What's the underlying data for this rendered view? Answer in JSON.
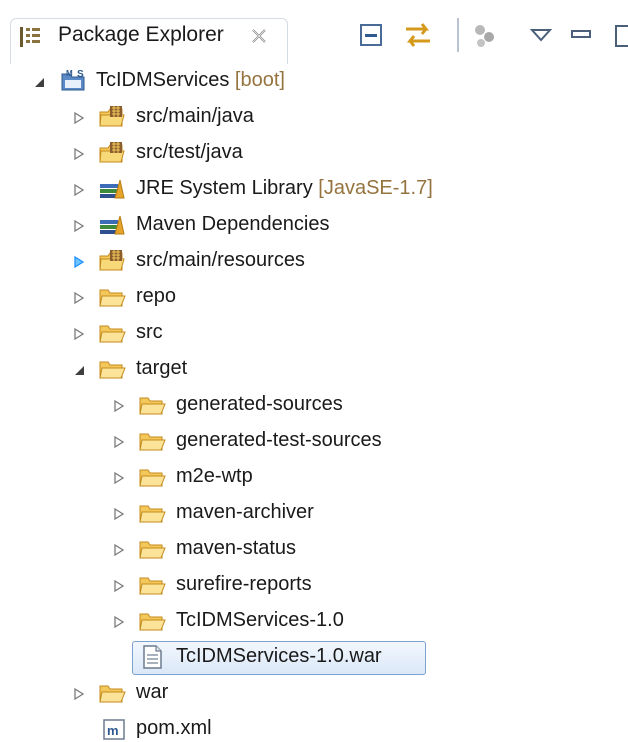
{
  "view": {
    "title": "Package Explorer",
    "close_icon": "close-icon",
    "toolbar": [
      "collapse-all-icon",
      "link-with-editor-icon",
      "filters-icon",
      "view-menu-icon",
      "minimize-icon",
      "maximize-icon"
    ]
  },
  "tree": {
    "project": {
      "name": "TcIDMServices",
      "decoration": " [boot]",
      "icon": "maven-project-icon",
      "expanded": true
    },
    "children": [
      {
        "label": "src/main/java",
        "icon": "source-folder-icon",
        "expanded": false
      },
      {
        "label": "src/test/java",
        "icon": "source-folder-icon",
        "expanded": false
      },
      {
        "label": "JRE System Library",
        "decoration": " [JavaSE-1.7]",
        "icon": "library-icon",
        "expanded": false
      },
      {
        "label": "Maven Dependencies",
        "icon": "library-icon",
        "expanded": false
      },
      {
        "label": "src/main/resources",
        "icon": "source-folder-icon",
        "expanded": false,
        "twisty_highlight": true
      },
      {
        "label": "repo",
        "icon": "folder-icon",
        "expanded": false
      },
      {
        "label": "src",
        "icon": "folder-icon",
        "expanded": false
      },
      {
        "label": "target",
        "icon": "folder-icon",
        "expanded": true,
        "children": [
          {
            "label": "generated-sources",
            "icon": "folder-icon"
          },
          {
            "label": "generated-test-sources",
            "icon": "folder-icon"
          },
          {
            "label": "m2e-wtp",
            "icon": "folder-icon"
          },
          {
            "label": "maven-archiver",
            "icon": "folder-icon"
          },
          {
            "label": "maven-status",
            "icon": "folder-icon"
          },
          {
            "label": "surefire-reports",
            "icon": "folder-icon"
          },
          {
            "label": "TcIDMServices-1.0",
            "icon": "folder-icon"
          },
          {
            "label": "TcIDMServices-1.0.war",
            "icon": "file-icon",
            "selected": true
          }
        ]
      },
      {
        "label": "war",
        "icon": "folder-icon",
        "expanded": false
      },
      {
        "label": "pom.xml",
        "icon": "maven-pom-icon"
      }
    ]
  },
  "colors": {
    "decoration": "#95743f",
    "selection_border": "#7da2ce",
    "twisty_highlight": "#1e90ff"
  }
}
